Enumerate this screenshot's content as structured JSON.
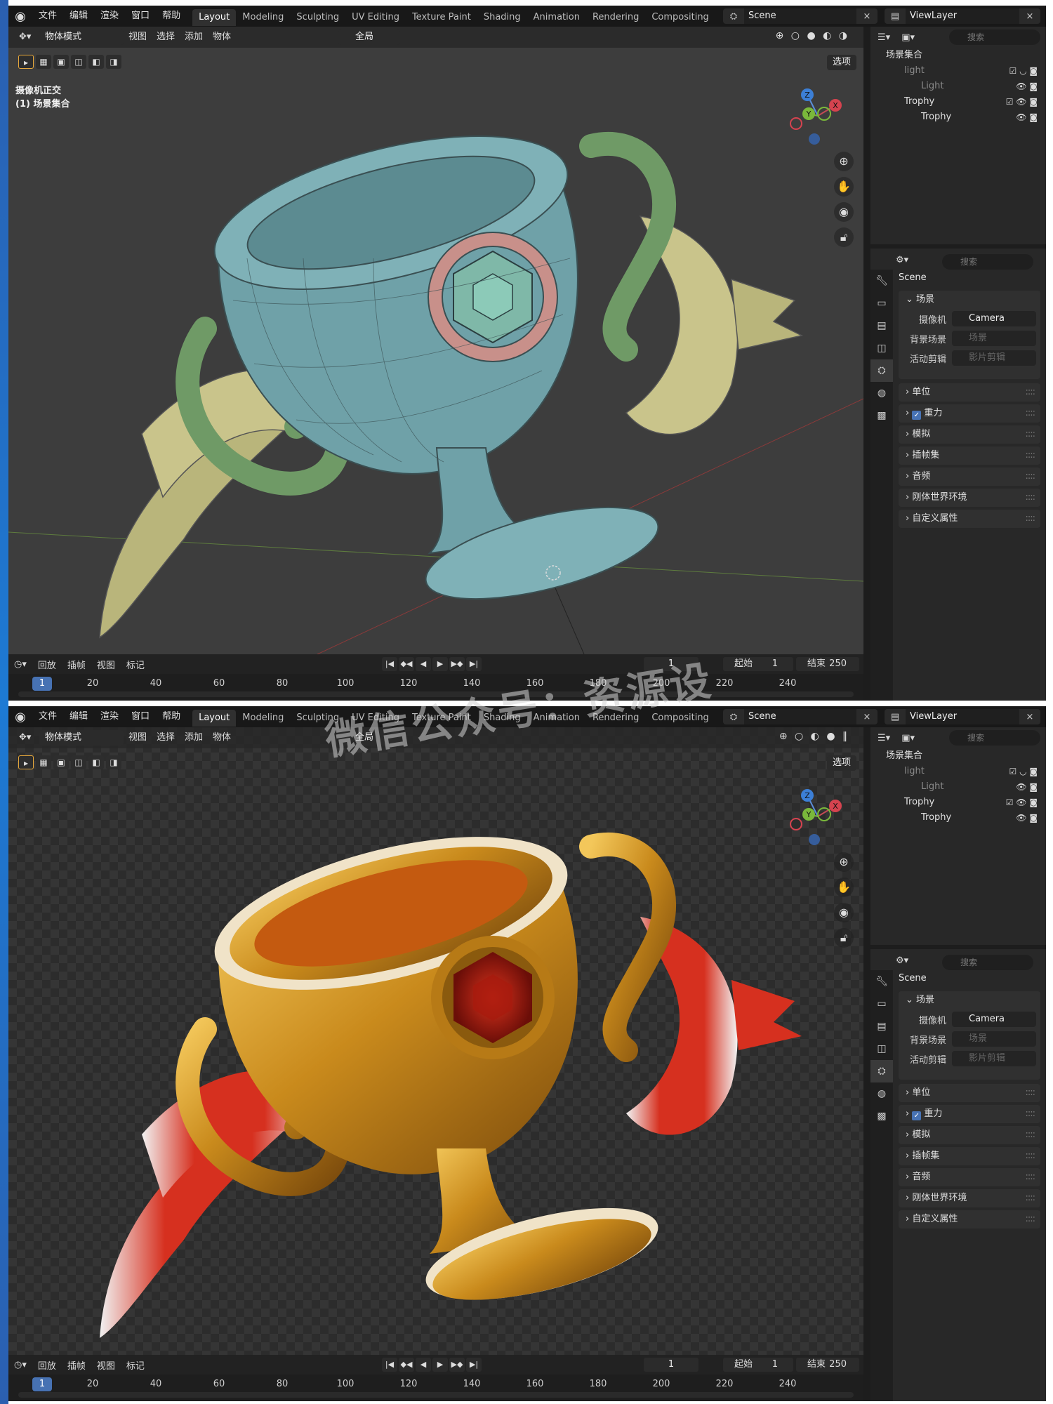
{
  "menu": [
    "文件",
    "编辑",
    "渲染",
    "窗口",
    "帮助"
  ],
  "workspaces": [
    "Layout",
    "Modeling",
    "Sculpting",
    "UV Editing",
    "Texture Paint",
    "Shading",
    "Animation",
    "Rendering",
    "Compositing"
  ],
  "active_workspace": "Layout",
  "scene_name": "Scene",
  "view_layer": "ViewLayer",
  "viewport": {
    "mode": "物体模式",
    "menus": [
      "视图",
      "选择",
      "添加",
      "物体"
    ],
    "transform_orientation": "全局",
    "options_label": "选项",
    "camera_label_line1": "摄像机正交",
    "camera_label_line2": "(1) 场景集合"
  },
  "gizmo_axes": [
    "Z",
    "Y",
    "X"
  ],
  "timeline": {
    "menus": [
      "回放",
      "插帧",
      "视图",
      "标记"
    ],
    "current_frame": "1",
    "start_label": "起始",
    "start_value": "1",
    "end_label": "结束",
    "end_value": "250",
    "ticks": [
      "1",
      "20",
      "40",
      "60",
      "80",
      "100",
      "120",
      "140",
      "160",
      "180",
      "200",
      "220",
      "240"
    ]
  },
  "outliner": {
    "search_placeholder": "搜索",
    "root": "场景集合",
    "items": [
      {
        "label": "light",
        "dim": true
      },
      {
        "label": "Light",
        "dim": true
      },
      {
        "label": "Trophy",
        "dim": false
      },
      {
        "label": "Trophy",
        "dim": false
      }
    ]
  },
  "properties": {
    "search_placeholder": "搜索",
    "scene_title": "Scene",
    "panel_scene": "场景",
    "camera_label": "摄像机",
    "camera_value": "Camera",
    "background_label": "背景场景",
    "background_value": "场景",
    "clip_label": "活动剪辑",
    "clip_value": "影片剪辑",
    "subpanels": [
      "单位",
      "重力",
      "模拟",
      "插帧集",
      "音频",
      "刚体世界环境",
      "自定义属性"
    ]
  },
  "watermark": "微信公众号：资源设"
}
